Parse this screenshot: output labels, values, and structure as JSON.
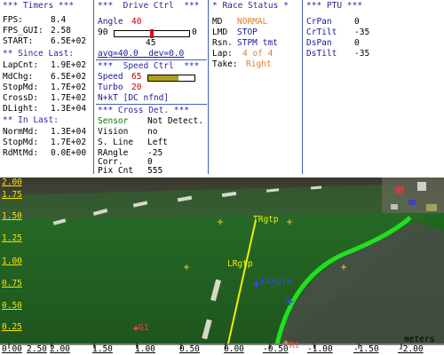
{
  "timers": {
    "header": "*** Timers ***",
    "fps_label": "FPS:",
    "fps_value": "8.4",
    "fps_gui_label": "FPS_GUI:",
    "fps_gui_value": "2.58",
    "start_label": "START:",
    "start_value": "6.5E+02",
    "since_last_header": "** Since Last:",
    "lapcnt_label": "LapCnt:",
    "lapcnt_value": "1.9E+02",
    "mdchg_label": "MdChg:",
    "mdchg_value": "6.5E+02",
    "stopmd_label": "StopMd:",
    "stopmd_value": "1.7E+02",
    "crossd_label": "CrossD:",
    "crossd_value": "1.7E+02",
    "dlight_label": "DLight:",
    "dlight_value": "1.3E+04",
    "in_last_header": "** In Last:",
    "normmd_label": "NormMd:",
    "normmd_value": "1.3E+04",
    "stopmd2_label": "StopMd:",
    "stopmd2_value": "1.7E+02",
    "rdmtmd_label": "RdMtMd:",
    "rdmtmd_value": "0.0E+00"
  },
  "drive_ctrl": {
    "header": "***  Drive Ctrl  ***",
    "angle_label": "Angle",
    "angle_value": "40",
    "slider_min": "90",
    "slider_max": "0",
    "slider_level": 0.5,
    "slider_center": "45",
    "avg_line": "avg=40.0  dev=0.0"
  },
  "speed_ctrl": {
    "header": "***  Speed Ctrl  ***",
    "speed_label": "Speed",
    "speed_value": "65",
    "speed_level": 0.65,
    "turbo_label": "Turbo",
    "turbo_value": "20",
    "nkt_line": "N+kT [DC nfnd]"
  },
  "cross_det": {
    "header": "*** Cross Det. ***",
    "sensor_label": "Sensor",
    "sensor_value": "Not Detect.",
    "vision_label": "Vision",
    "vision_value": "no",
    "sline_label": "S. Line",
    "sline_value": "Left",
    "rangle_label": "RAngle",
    "rangle_value": "-25",
    "corr_label": "Corr.",
    "corr_value": "0",
    "pixcnt_label": "Pix Cnt",
    "pixcnt_value": "555"
  },
  "race_status": {
    "header": "* Race Status *",
    "md_label": "MD",
    "md_value": "NORMAL",
    "lmd_label": "LMD",
    "lmd_value": "STOP",
    "rsn_label": "Rsn.",
    "rsn_value": "STPM tmt",
    "lap_label": "Lap:",
    "lap_value": "4 of 4",
    "take_label": "Take:",
    "take_value": "Right"
  },
  "ptu": {
    "header": "*** PTU ***",
    "crpan_label": "CrPan",
    "crpan_value": "0",
    "crtilt_label": "CrTilt",
    "crtilt_value": "-35",
    "dspan_label": "DsPan",
    "dspan_value": "0",
    "dstilt_label": "DsTilt",
    "dstilt_value": "-35"
  },
  "video": {
    "y_labels": [
      "2.00",
      "1.75",
      "1.50",
      "1.25",
      "1.00",
      "0.75",
      "0.50",
      "0.25",
      "0.00"
    ],
    "x_labels": [
      "2.50",
      "2.00",
      "1.50",
      "1.00",
      "0.50",
      "0.00",
      "-0.50",
      "-1.00",
      "-1.50",
      "-2.00"
    ],
    "units": "meters",
    "overlay_labels": {
      "trgtp": "TRgtp",
      "lrgtp": "LRgtp",
      "langle": "LAngle",
      "g1": "G1",
      "rt": "Rt"
    },
    "colors": {
      "track_line": "#20e020",
      "target_line": "#f0f000",
      "marker": "#f0c040"
    }
  }
}
